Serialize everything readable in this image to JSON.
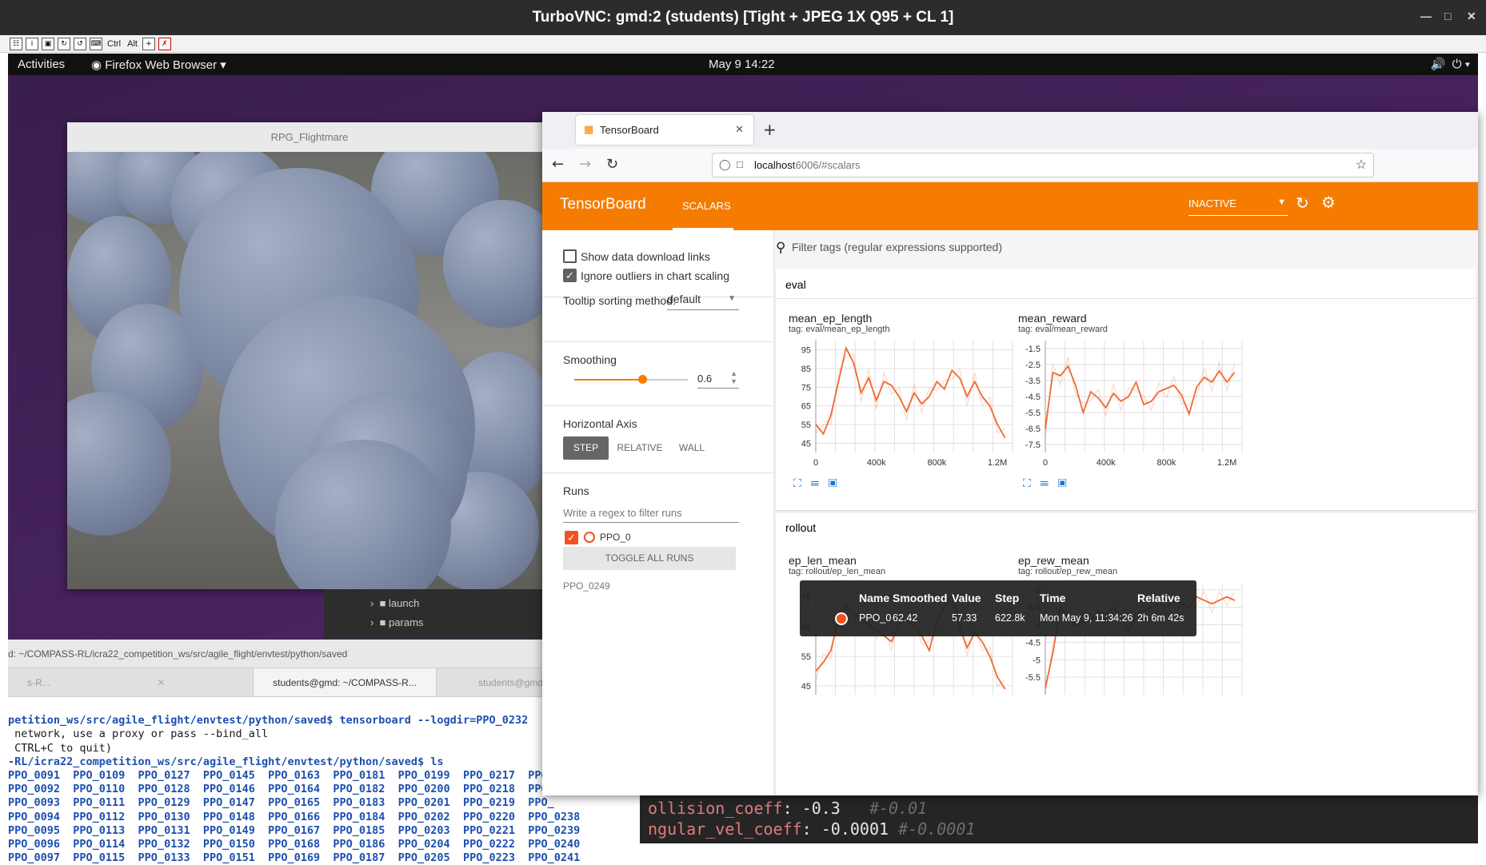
{
  "vnc": {
    "title": "TurboVNC: gmd:2 (students) [Tight + JPEG 1X Q95 + CL 1]",
    "toolbar_ctrl": "Ctrl",
    "toolbar_alt": "Alt"
  },
  "gnome": {
    "activities": "Activities",
    "app_name": "Firefox Web Browser",
    "clock": "May 9  14:22"
  },
  "flightmare": {
    "title": "RPG_Flightmare"
  },
  "filetree": {
    "items": [
      "launch",
      "params"
    ]
  },
  "terminal": {
    "path_title": "d: ~/COMPASS-RL/icra22_competition_ws/src/agile_flight/envtest/python/saved",
    "tabs": [
      "s-R...",
      "students@gmd: ~/COMPASS-R...",
      "students@gmd: ~/COM"
    ],
    "lines": [
      "petition_ws/src/agile_flight/envtest/python/saved$ tensorboard --logdir=PPO_0232",
      " network, use a proxy or pass --bind_all",
      " CTRL+C to quit)",
      "-RL/icra22_competition_ws/src/agile_flight/envtest/python/saved$ ls"
    ],
    "ls_rows": [
      "PPO_0091  PPO_0109  PPO_0127  PPO_0145  PPO_0163  PPO_0181  PPO_0199  PPO_0217  PPO_",
      "PPO_0092  PPO_0110  PPO_0128  PPO_0146  PPO_0164  PPO_0182  PPO_0200  PPO_0218  PPO_",
      "PPO_0093  PPO_0111  PPO_0129  PPO_0147  PPO_0165  PPO_0183  PPO_0201  PPO_0219  PPO_",
      "PPO_0094  PPO_0112  PPO_0130  PPO_0148  PPO_0166  PPO_0184  PPO_0202  PPO_0220  PPO_0238",
      "PPO_0095  PPO_0113  PPO_0131  PPO_0149  PPO_0167  PPO_0185  PPO_0203  PPO_0221  PPO_0239",
      "PPO_0096  PPO_0114  PPO_0132  PPO_0150  PPO_0168  PPO_0186  PPO_0204  PPO_0222  PPO_0240",
      "PPO_0097  PPO_0115  PPO_0133  PPO_0151  PPO_0169  PPO_0187  PPO_0205  PPO_0223  PPO_0241"
    ]
  },
  "editor": {
    "line1_key": "ollision_coeff",
    "line1_val": ": -0.3",
    "line1_comment": "#-0.01",
    "line2_key": "ngular_vel_coeff",
    "line2_val": ": -0.0001",
    "line2_comment": "#-0.0001"
  },
  "browser": {
    "tab_title": "TensorBoard",
    "url_host": "localhost",
    "url_rest": ":6006/#scalars"
  },
  "tensorboard": {
    "brand": "TensorBoard",
    "nav_scalars": "SCALARS",
    "status": "INACTIVE",
    "settings": {
      "show_download": "Show data download links",
      "show_download_checked": false,
      "ignore_outliers": "Ignore outliers in chart scaling",
      "ignore_outliers_checked": true,
      "tooltip_label": "Tooltip sorting method:",
      "tooltip_value": "default",
      "smoothing_label": "Smoothing",
      "smoothing_value": "0.6",
      "smoothing_fraction": 0.6,
      "haxis_label": "Horizontal Axis",
      "haxis_options": [
        "STEP",
        "RELATIVE",
        "WALL"
      ],
      "haxis_selected": "STEP",
      "runs_label": "Runs",
      "runs_filter_placeholder": "Write a regex to filter runs",
      "run_name": "PPO_0",
      "toggle_all": "TOGGLE ALL RUNS",
      "run_dir": "PPO_0249"
    },
    "filter_placeholder": "Filter tags (regular expressions supported)",
    "groups": [
      "eval",
      "rollout"
    ],
    "accent_color": "#f57c00",
    "series_color": "#f06a32"
  },
  "chart_data": [
    {
      "type": "line",
      "title": "mean_ep_length",
      "subtitle": "tag: eval/mean_ep_length",
      "x_ticks": [
        "0",
        "400k",
        "800k",
        "1.2M"
      ],
      "y_ticks": [
        "95",
        "85",
        "75",
        "65",
        "55",
        "45"
      ],
      "xlim": [
        0,
        1300000
      ],
      "ylim": [
        40,
        100
      ],
      "x": [
        0,
        50000,
        100000,
        150000,
        200000,
        250000,
        300000,
        350000,
        400000,
        450000,
        500000,
        550000,
        600000,
        650000,
        700000,
        750000,
        800000,
        850000,
        900000,
        950000,
        1000000,
        1050000,
        1100000,
        1150000,
        1200000,
        1250000
      ],
      "series": [
        {
          "values": [
            55,
            50,
            60,
            78,
            96,
            88,
            72,
            80,
            68,
            78,
            76,
            70,
            62,
            72,
            66,
            70,
            78,
            74,
            84,
            80,
            70,
            78,
            70,
            65,
            55,
            48
          ]
        }
      ]
    },
    {
      "type": "line",
      "title": "mean_reward",
      "subtitle": "tag: eval/mean_reward",
      "x_ticks": [
        "0",
        "400k",
        "800k",
        "1.2M"
      ],
      "y_ticks": [
        "-1.5",
        "-2.5",
        "-3.5",
        "-4.5",
        "-5.5",
        "-6.5",
        "-7.5"
      ],
      "xlim": [
        0,
        1300000
      ],
      "ylim": [
        -8,
        -1
      ],
      "x": [
        0,
        50000,
        100000,
        150000,
        200000,
        250000,
        300000,
        350000,
        400000,
        450000,
        500000,
        550000,
        600000,
        650000,
        700000,
        750000,
        800000,
        850000,
        900000,
        950000,
        1000000,
        1050000,
        1100000,
        1150000,
        1200000,
        1250000
      ],
      "series": [
        {
          "values": [
            -6.5,
            -3.0,
            -3.2,
            -2.6,
            -3.8,
            -5.5,
            -4.2,
            -4.6,
            -5.2,
            -4.3,
            -4.8,
            -4.5,
            -3.6,
            -5.0,
            -4.8,
            -4.2,
            -4.0,
            -3.8,
            -4.4,
            -5.6,
            -3.9,
            -3.3,
            -3.6,
            -2.9,
            -3.6,
            -3.0
          ]
        }
      ]
    },
    {
      "type": "line",
      "title": "ep_len_mean",
      "subtitle": "tag: rollout/ep_len_mean",
      "x_ticks": [],
      "y_ticks": [
        "75",
        "65",
        "55",
        "45"
      ],
      "xlim": [
        0,
        1300000
      ],
      "ylim": [
        42,
        80
      ],
      "x": [
        0,
        50000,
        100000,
        150000,
        200000,
        250000,
        300000,
        350000,
        400000,
        450000,
        500000,
        550000,
        600000,
        650000,
        700000,
        750000,
        800000,
        850000,
        900000,
        950000,
        1000000,
        1050000,
        1100000,
        1150000,
        1200000,
        1250000
      ],
      "series": [
        {
          "values": [
            50,
            53,
            57,
            68,
            72,
            70,
            67,
            66,
            64,
            62,
            60,
            66,
            68,
            65,
            62,
            57,
            67,
            72,
            76,
            65,
            58,
            63,
            60,
            55,
            48,
            44
          ]
        }
      ]
    },
    {
      "type": "line",
      "title": "ep_rew_mean",
      "subtitle": "tag: rollout/ep_rew_mean",
      "x_ticks": [],
      "y_ticks": [
        "-3",
        "-3.5",
        "-4",
        "-4.5",
        "-5",
        "-5.5"
      ],
      "xlim": [
        0,
        1300000
      ],
      "ylim": [
        -6,
        -2.8
      ],
      "x": [
        0,
        50000,
        100000,
        150000,
        200000,
        250000,
        300000,
        350000,
        400000,
        450000,
        500000,
        550000,
        600000,
        650000,
        700000,
        750000,
        800000,
        850000,
        900000,
        950000,
        1000000,
        1050000,
        1100000,
        1150000,
        1200000,
        1250000
      ],
      "series": [
        {
          "values": [
            -5.8,
            -4.8,
            -3.5,
            -3.8,
            -4.0,
            -3.9,
            -3.9,
            -3.6,
            -3.7,
            -3.5,
            -3.8,
            -4.2,
            -3.7,
            -3.6,
            -3.5,
            -3.4,
            -3.5,
            -3.3,
            -3.4,
            -3.5,
            -3.2,
            -3.3,
            -3.4,
            -3.3,
            -3.2,
            -3.3
          ]
        }
      ]
    }
  ],
  "tooltip": {
    "headers": [
      "Name",
      "Smoothed",
      "Value",
      "Step",
      "Time",
      "Relative"
    ],
    "row": [
      "PPO_0",
      "62.42",
      "57.33",
      "622.8k",
      "Mon May 9, 11:34:26",
      "2h 6m 42s"
    ]
  }
}
